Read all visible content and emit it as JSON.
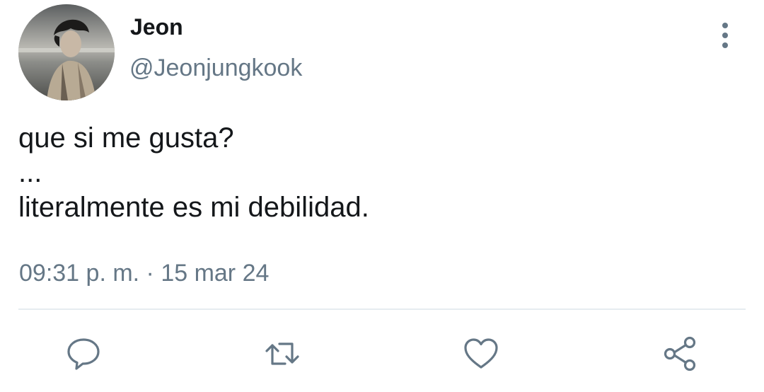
{
  "author": {
    "display_name": "Jeon",
    "handle": "@Jeonjungkook"
  },
  "tweet": {
    "lines": [
      "que si me gusta?",
      "...",
      "literalmente es mi debilidad."
    ],
    "timestamp": "09:31 p. m. · 15 mar 24"
  },
  "icons": {
    "more": "more-vertical-icon",
    "reply": "reply-icon",
    "retweet": "retweet-icon",
    "like": "heart-icon",
    "share": "share-icon"
  },
  "colors": {
    "text_primary": "#14171a",
    "text_secondary": "#657786",
    "divider": "#e6ecf0"
  }
}
